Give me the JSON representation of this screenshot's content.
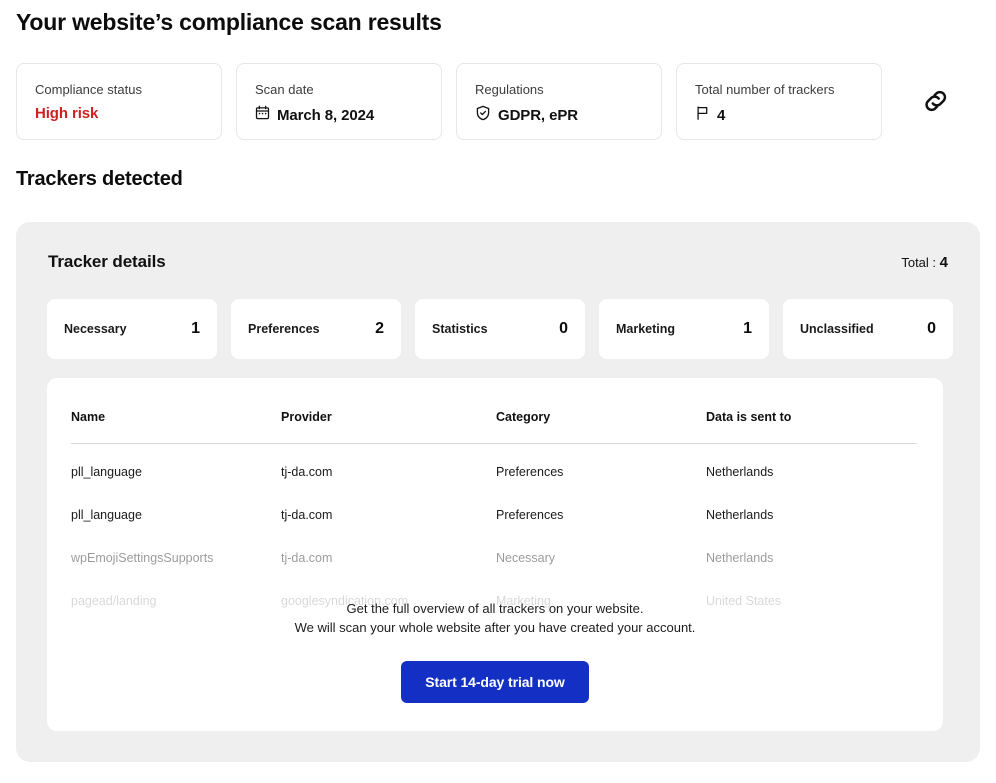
{
  "page_title": "Your website’s compliance scan results",
  "summary_cards": [
    {
      "label": "Compliance status",
      "value": "High risk",
      "icon": "",
      "risk": true
    },
    {
      "label": "Scan date",
      "value": "March 8, 2024",
      "icon": "calendar-icon",
      "risk": false
    },
    {
      "label": "Regulations",
      "value": "GDPR, ePR",
      "icon": "shield-check-icon",
      "risk": false
    },
    {
      "label": "Total number of trackers",
      "value": "4",
      "icon": "flag-icon",
      "risk": false
    }
  ],
  "link_icon": "link-icon",
  "section_title": "Trackers detected",
  "panel": {
    "title": "Tracker details",
    "total_label": "Total :",
    "total_value": "4"
  },
  "categories": [
    {
      "name": "Necessary",
      "count": "1"
    },
    {
      "name": "Preferences",
      "count": "2"
    },
    {
      "name": "Statistics",
      "count": "0"
    },
    {
      "name": "Marketing",
      "count": "1"
    },
    {
      "name": "Unclassified",
      "count": "0"
    }
  ],
  "table": {
    "headers": [
      "Name",
      "Provider",
      "Category",
      "Data is sent to"
    ],
    "rows": [
      {
        "name": "pll_language",
        "provider": "tj-da.com",
        "category": "Preferences",
        "sent_to": "Netherlands"
      },
      {
        "name": "pll_language",
        "provider": "tj-da.com",
        "category": "Preferences",
        "sent_to": "Netherlands"
      },
      {
        "name": "wpEmojiSettingsSupports",
        "provider": "tj-da.com",
        "category": "Necessary",
        "sent_to": "Netherlands"
      },
      {
        "name": "pagead/landing",
        "provider": "googlesyndication.com",
        "category": "Marketing",
        "sent_to": "United States"
      }
    ]
  },
  "cta": {
    "line1": "Get the full overview of all trackers on your website.",
    "line2": "We will scan your whole website after you have created your account.",
    "button": "Start 14-day trial now"
  },
  "colors": {
    "risk_red": "#cf2020",
    "cta_blue": "#1430c4",
    "panel_gray": "#efefef"
  }
}
